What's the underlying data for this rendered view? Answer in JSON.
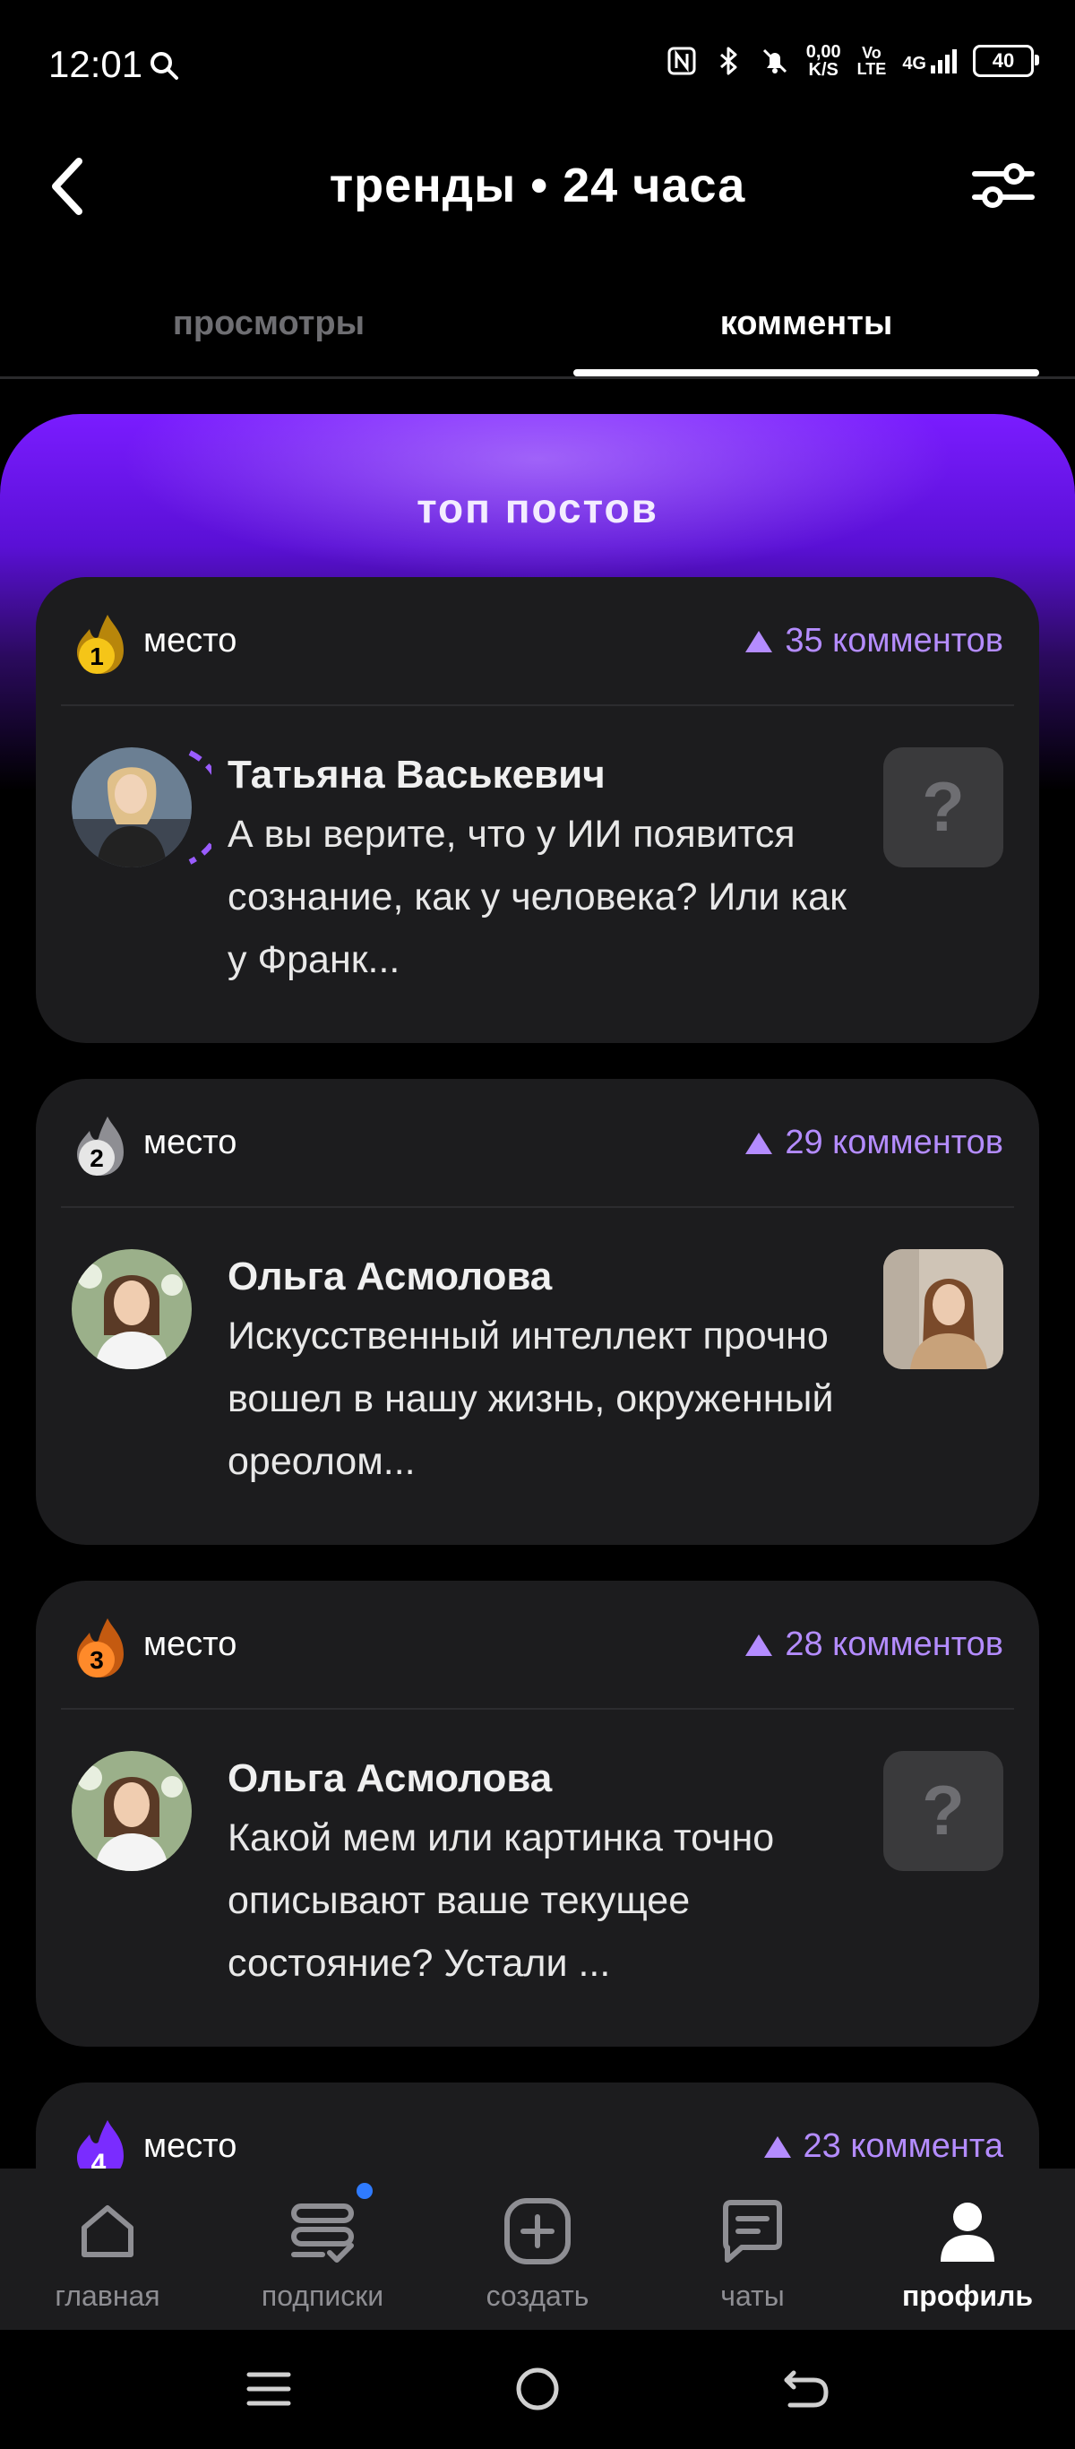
{
  "status_bar": {
    "time": "12:01",
    "speed_value": "0,00",
    "speed_unit": "K/S",
    "volte_top": "Vo",
    "volte_bottom": "LTE",
    "network": "4G",
    "battery": "40"
  },
  "header": {
    "title": "тренды • 24 часа",
    "back_icon": "chevron-left-icon",
    "filter_icon": "sliders-icon"
  },
  "tabs": [
    {
      "label": "просмотры",
      "active": false
    },
    {
      "label": "комменты",
      "active": true
    }
  ],
  "hero": {
    "title": "топ постов"
  },
  "posts": [
    {
      "rank": "1",
      "rank_label": "место",
      "rank_color": "#f5c518",
      "comments": "35 комментов",
      "author": "Татьяна Васькевич",
      "text": "А вы верите, что у ИИ появится сознание, как у человека? Или как у Франк...",
      "thumb": "question-icon"
    },
    {
      "rank": "2",
      "rank_label": "место",
      "rank_color": "#d9d9d9",
      "comments": "29 комментов",
      "author": "Ольга Асмолова",
      "text": "Искусственный интеллект прочно вошел в нашу жизнь, окруженный ореолом...",
      "thumb": "photo"
    },
    {
      "rank": "3",
      "rank_label": "место",
      "rank_color": "#ff8a2a",
      "comments": "28 комментов",
      "author": "Ольга Асмолова",
      "text": "Какой мем или картинка точно описывают ваше текущее состояние? Устали ...",
      "thumb": "question-icon"
    },
    {
      "rank": "4",
      "rank_label": "место",
      "rank_color": "#7a2cff",
      "comments": "23 коммента"
    }
  ],
  "bottom_nav": [
    {
      "label": "главная",
      "icon": "home-icon",
      "active": false
    },
    {
      "label": "подписки",
      "icon": "subscriptions-icon",
      "active": false,
      "badge": true
    },
    {
      "label": "создать",
      "icon": "plus-square-icon",
      "active": false
    },
    {
      "label": "чаты",
      "icon": "chat-icon",
      "active": false
    },
    {
      "label": "профиль",
      "icon": "profile-icon",
      "active": true
    }
  ],
  "colors": {
    "accent": "#b48cff",
    "hero_purple": "#7a1cff",
    "card_bg": "#1c1c1e"
  }
}
